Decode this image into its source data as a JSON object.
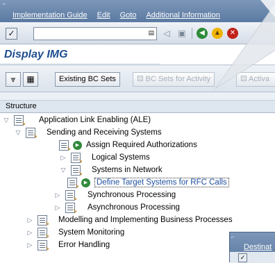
{
  "menubar": {
    "items": [
      "Implementation Guide",
      "Edit",
      "Goto",
      "Additional Information"
    ]
  },
  "system_toolbar": {
    "command_field_value": "",
    "icons": [
      "enter-icon",
      "back-icon",
      "save-icon",
      "back-green-icon",
      "exit-yellow-icon",
      "cancel-red-icon"
    ]
  },
  "title": "Display IMG",
  "app_toolbar": {
    "existing_bc_sets": "Existing BC Sets",
    "bc_sets_for_activity": "BC Sets for Activity",
    "activate_truncated": "Activa"
  },
  "tree": {
    "header": "Structure",
    "nodes": [
      {
        "label": "Application Link Enabling (ALE)"
      },
      {
        "label": "Sending and Receiving Systems"
      },
      {
        "label": "Assign Required Authorizations"
      },
      {
        "label": "Logical Systems"
      },
      {
        "label": "Systems in Network"
      },
      {
        "label": "Define Target Systems for RFC Calls"
      },
      {
        "label": "Synchronous Processing"
      },
      {
        "label": "Asynchronous Processing"
      },
      {
        "label": "Modelling and Implementing Business Processes"
      },
      {
        "label": "System Monitoring"
      },
      {
        "label": "Error Handling"
      }
    ]
  },
  "popup": {
    "menu_truncated": "Destinat"
  }
}
